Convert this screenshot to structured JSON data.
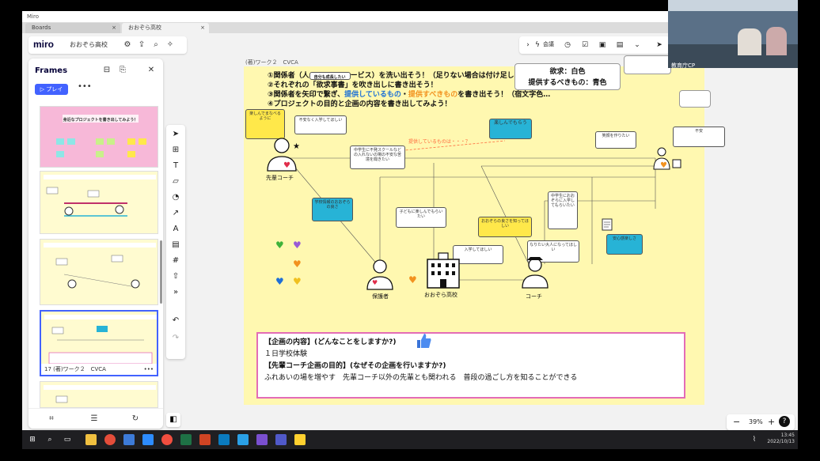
{
  "window": {
    "title": "Miro",
    "tabs": [
      {
        "label": "Boards"
      },
      {
        "label": "おおぞら高校"
      }
    ]
  },
  "topbar": {
    "logo": "miro",
    "board_name": "おおぞら高校"
  },
  "frames_panel": {
    "title": "Frames",
    "play_label": "▷ プレイ",
    "more_label": "•••",
    "thumb1_heading": "身近なプロジェクトを書き出してみよう！",
    "selected_frame_label": "17 (著)ワーク２　CVCA"
  },
  "canvas": {
    "frame_label": "(著)ワーク２　CVCA",
    "instructions": {
      "line1_a": "①関係者（人",
      "line1_b": "ービス）を洗い出そう！（足りない場合は付け足しOK）",
      "line2": "②それぞれの「欲求事書」を吹き出しに書き出そう！",
      "line3_a": "③関係者を矢印で繋ぎ、",
      "line3_b": "提供しているもの",
      "line3_c": "・",
      "line3_d": "提供すべきもの",
      "line3_e": "を書き出そう！（宿文字色…",
      "line4": "④プロジェクトの目的と企画の内容を書き出してみよう！"
    },
    "legend": {
      "line1": "欲求：白色",
      "line2": "提供するべきもの：青色"
    },
    "arrow_label": "提供しているものは・・・？",
    "people": {
      "senpai": "先輩コーチ",
      "parent": "保護者",
      "school": "おおぞら高校",
      "coach": "コーチ"
    },
    "notes": {
      "n1": "楽しんでまなべるように",
      "n2": "自分も成長したい",
      "n3": "不安なく入学してほしい",
      "n4": "中学生に不発スクールなどの入れないの場の不安な苦境を聞きたい",
      "n5": "楽しんでもらう",
      "n6": "笑顔を作りたい",
      "n7": "不安",
      "n8": "学校情報のおおぞらの良さ",
      "n9": "子どもに楽しんでもらいたい",
      "n10": "おおぞらの良さを知ってほしい",
      "n11": "中学生におおぞらに入学してもらいたい",
      "n12": "入学してほしい",
      "n13": "なりたい大人になってほしい",
      "n14": "安心感楽しさ"
    },
    "content_box": {
      "q1": "【企画の内容】(どんなことをしますか?)",
      "a1": "１日学校体験",
      "q2": "【先輩コーチ企画の目的】(なぜその企画を行いますか?)",
      "a2": "ふれあいの場を増やす　先輩コーチ以外の先輩とも関われる　普段の過ごし方を知ることができる"
    }
  },
  "top_right": {
    "meeting_label": "会議"
  },
  "video": {
    "name": "教育庁CP"
  },
  "zoom": {
    "minus": "−",
    "value": "39%",
    "plus": "+",
    "help": "?"
  },
  "taskbar": {
    "time": "13:45",
    "date": "2022/10/13"
  },
  "colors": {
    "board_bg": "#fff8b0",
    "accent": "#4262ff",
    "cyan_note": "#27b3d6",
    "yellow_note": "#ffe84a",
    "pink_border": "#e36cb6"
  }
}
